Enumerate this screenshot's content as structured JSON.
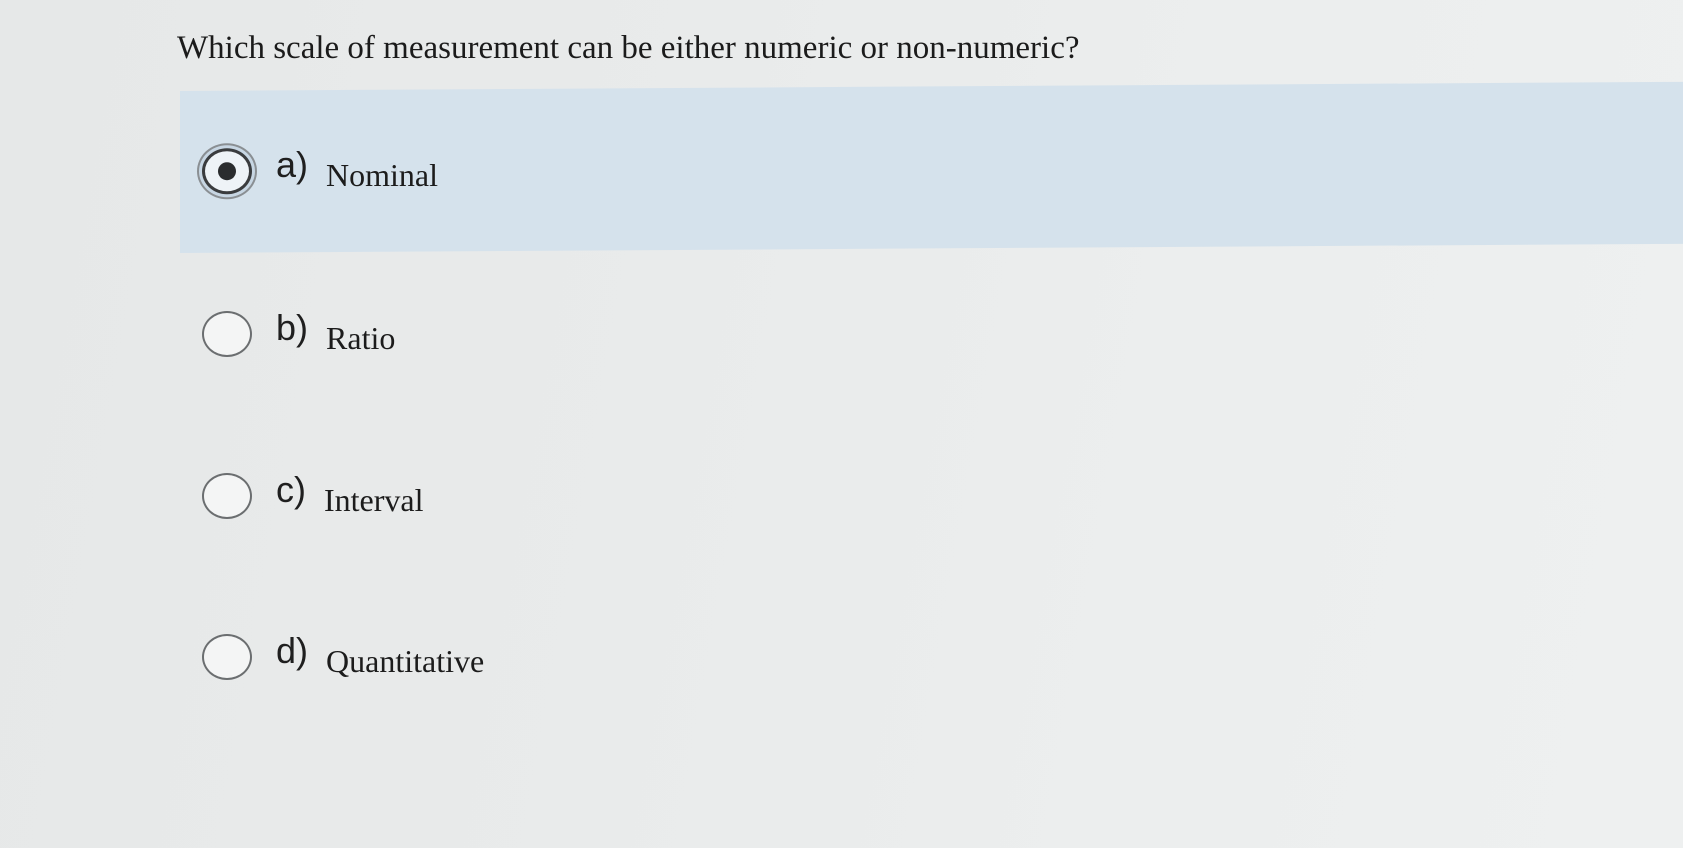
{
  "question": {
    "text": "Which scale of measurement can be either numeric or non-numeric?"
  },
  "options": [
    {
      "letter": "a)",
      "label": "Nominal",
      "selected": true
    },
    {
      "letter": "b)",
      "label": "Ratio",
      "selected": false
    },
    {
      "letter": "c)",
      "label": "Interval",
      "selected": false
    },
    {
      "letter": "d)",
      "label": "Quantitative",
      "selected": false
    }
  ],
  "colors": {
    "selected_background": "#d5e2ec",
    "page_background": "#e9ebeb"
  }
}
